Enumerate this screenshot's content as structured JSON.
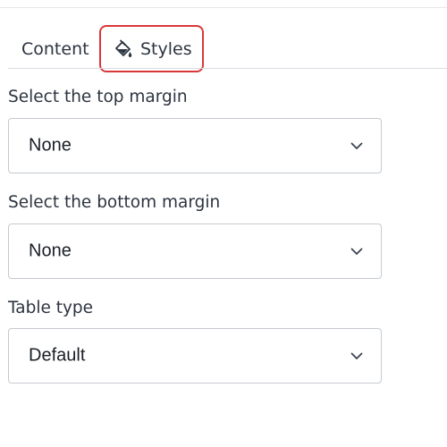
{
  "tabs": [
    {
      "label": "Content",
      "selected": false
    },
    {
      "label": "Styles",
      "selected": true,
      "icon": "paint-bucket-icon"
    }
  ],
  "fields": {
    "top_margin": {
      "label": "Select the top margin",
      "value": "None"
    },
    "bottom_margin": {
      "label": "Select the bottom margin",
      "value": "None"
    },
    "table_type": {
      "label": "Table type",
      "value": "Default"
    }
  },
  "colors": {
    "highlight_border": "#d9383a",
    "input_border": "#c5cad1",
    "text": "#2c3440"
  }
}
